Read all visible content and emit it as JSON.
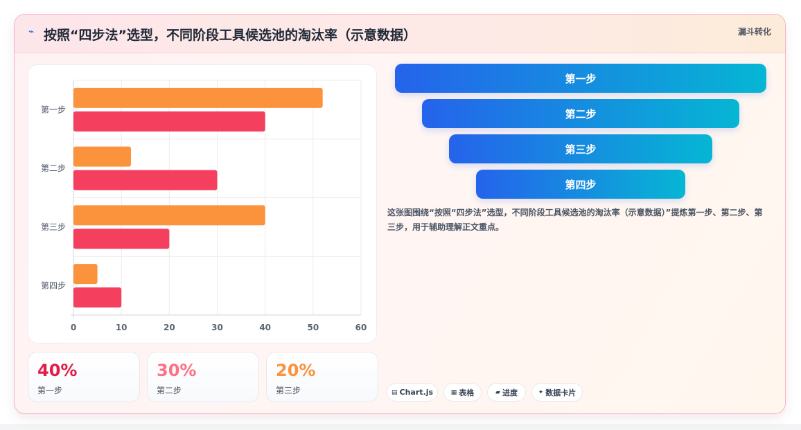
{
  "header": {
    "icon": "lightning-icon",
    "title": "按照“四步法”选型，不同阶段工具候选池的淘汰率（示意数据）",
    "tag": "漏斗转化"
  },
  "chart_data": {
    "type": "bar",
    "orientation": "horizontal",
    "categories": [
      "第一步",
      "第二步",
      "第三步",
      "第四步"
    ],
    "series": [
      {
        "color": "#fb923c",
        "values": [
          52,
          12,
          40,
          5
        ]
      },
      {
        "color": "#f43f5e",
        "values": [
          40,
          30,
          20,
          10
        ]
      }
    ],
    "xlim": [
      0,
      60
    ],
    "xticks": [
      0,
      10,
      20,
      30,
      40,
      50,
      60
    ],
    "grid": true,
    "legend": "none"
  },
  "stats": [
    {
      "value": "40%",
      "label": "第一步",
      "color": "#e11d48"
    },
    {
      "value": "30%",
      "label": "第二步",
      "color": "#fb7185"
    },
    {
      "value": "20%",
      "label": "第三步",
      "color": "#fb923c"
    }
  ],
  "funnel": {
    "steps": [
      "第一步",
      "第二步",
      "第三步",
      "第四步"
    ],
    "colors": {
      "start": "#2563eb",
      "end": "#06b6d4"
    }
  },
  "description": "这张图围绕“按照“四步法”选型，不同阶段工具候选池的淘汰率（示意数据）”提炼第一步、第二步、第三步，用于辅助理解正文重点。",
  "pills": [
    {
      "icon": "table-icon",
      "label": "Chart.js"
    },
    {
      "icon": "grid-icon",
      "label": "表格"
    },
    {
      "icon": "progress-icon",
      "label": "进度"
    },
    {
      "icon": "sparkle-icon",
      "label": "数据卡片"
    }
  ]
}
